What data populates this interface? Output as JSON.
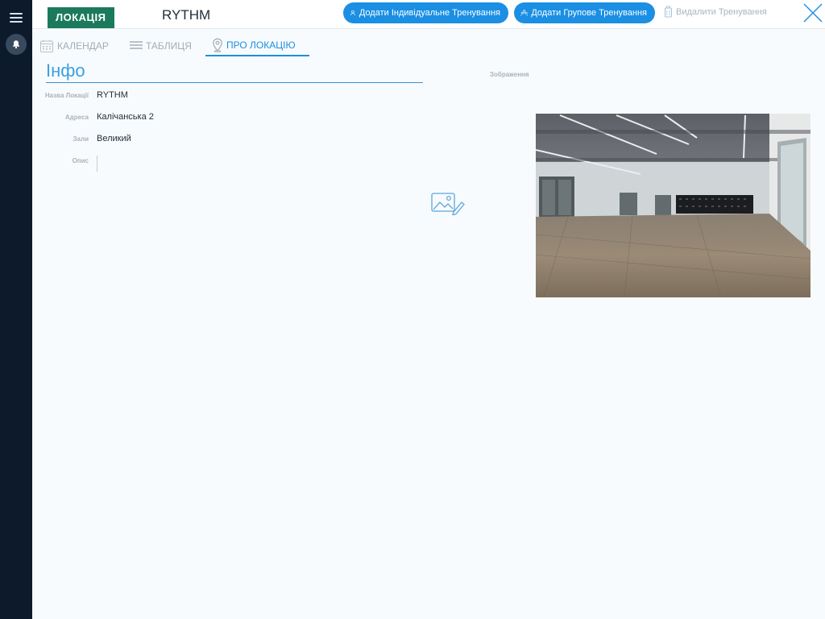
{
  "header": {
    "badge": "ЛОКАЦІЯ",
    "location_name": "RYTHM",
    "add_individual": "Додати Індивідуальне Тренування",
    "add_group": "Додати Групове Тренування",
    "delete": "Видалити Тренування"
  },
  "tabs": [
    {
      "label": "КАЛЕНДАР",
      "icon": "calendar-icon",
      "active": false
    },
    {
      "label": "ТАБЛИЦЯ",
      "icon": "table-icon",
      "active": false
    },
    {
      "label": "ПРО ЛОКАЦІЮ",
      "icon": "map-pin-icon",
      "active": true
    }
  ],
  "info": {
    "title": "Інфо",
    "fields": [
      {
        "label": "Назва Локації",
        "value": "RYTHM"
      },
      {
        "label": "Адреса",
        "value": "Калічанська 2"
      },
      {
        "label": "Зали",
        "value": "Великий"
      },
      {
        "label": "Опис",
        "value": ""
      }
    ],
    "image_label": "Зображення"
  },
  "colors": {
    "rail": "#0d1a2b",
    "accent": "#1a8fe3",
    "badge": "#1c7a5c",
    "background": "#f8fbfd"
  }
}
